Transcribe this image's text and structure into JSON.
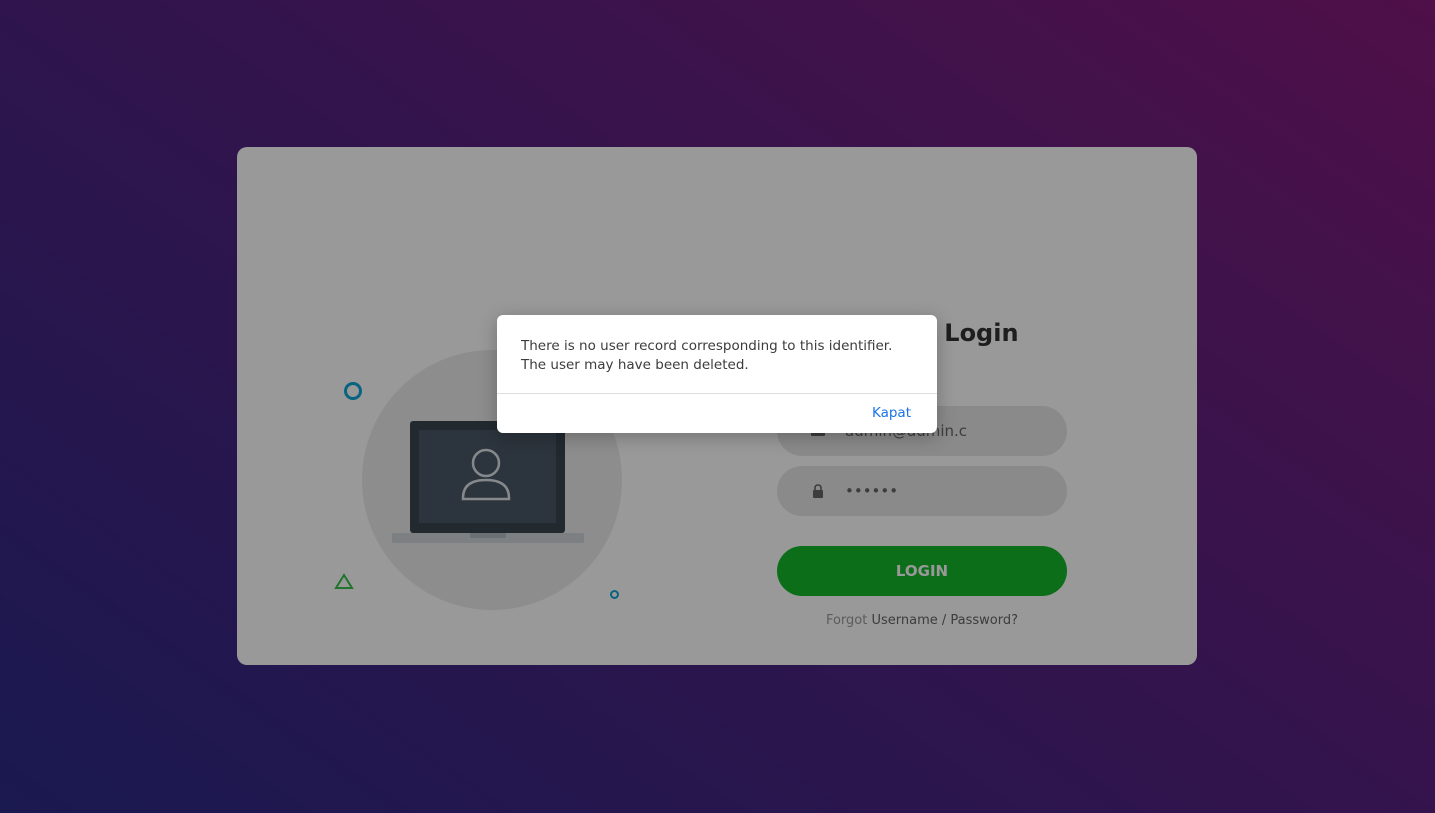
{
  "login": {
    "title": "Member Login",
    "email": {
      "value": "admin@admin.c",
      "icon": "envelope-icon"
    },
    "password": {
      "value": "••••••",
      "icon": "lock-icon"
    },
    "submit_label": "LOGIN",
    "forgot_prefix": "Forgot",
    "forgot_link": "Username / Password?"
  },
  "illustration": {
    "icon": "laptop-user-icon"
  },
  "dialog": {
    "message": "There is no user record corresponding to this identifier. The user may have been deleted.",
    "close_label": "Kapat"
  },
  "colors": {
    "accent_green": "#15b82a",
    "dialog_link_blue": "#1a73e8",
    "deco_blue": "#0ea5d8",
    "deco_green": "#38c24a"
  }
}
